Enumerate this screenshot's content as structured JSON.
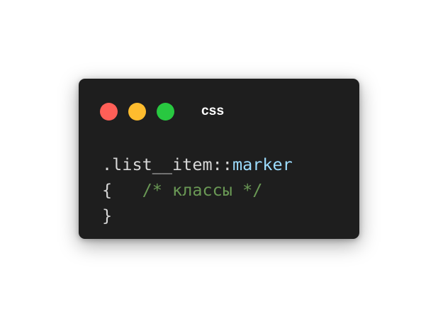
{
  "window": {
    "language_label": "css",
    "background": "#1e1e1e",
    "buttons": {
      "close_color": "#ff5f57",
      "minimize_color": "#febc2e",
      "maximize_color": "#28c840"
    }
  },
  "code": {
    "lines": [
      {
        "selector": ".list__item::",
        "pseudo": "marker"
      },
      {
        "open_brace": "{",
        "spacing": "   ",
        "comment": "/* классы */"
      },
      {
        "close_brace": "}"
      }
    ],
    "colors": {
      "text": "#d7d7d7",
      "pseudo_element": "#9cdcfe",
      "comment": "#6a9955"
    }
  }
}
